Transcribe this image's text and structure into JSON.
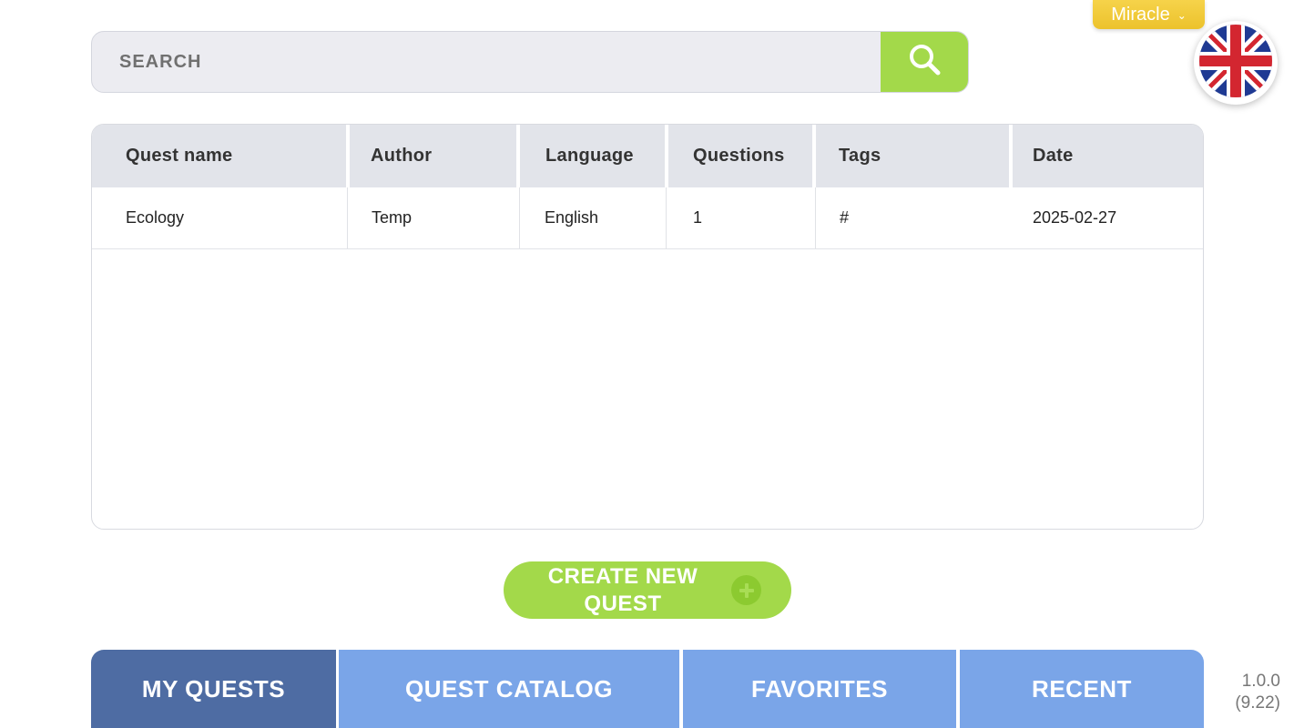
{
  "search": {
    "placeholder": "SEARCH"
  },
  "profile": {
    "name": "Miracle",
    "language_flag": "uk-flag-icon"
  },
  "table": {
    "columns": [
      "Quest name",
      "Author",
      "Language",
      "Questions",
      "Tags",
      "Date"
    ],
    "rows": [
      {
        "name": "Ecology",
        "author": "Temp",
        "language": "English",
        "questions": "1",
        "tags": "#",
        "date": "2025-02-27"
      }
    ]
  },
  "create_button": {
    "label": "CREATE NEW QUEST"
  },
  "tabs": [
    {
      "label": "MY QUESTS",
      "active": true
    },
    {
      "label": "QUEST CATALOG",
      "active": false
    },
    {
      "label": "FAVORITES",
      "active": false
    },
    {
      "label": "RECENT",
      "active": false
    }
  ],
  "version": {
    "app": "1.0.0",
    "build": "(9.22)"
  },
  "colors": {
    "accent_green": "#a3d94a",
    "tab_active": "#4e6ca3",
    "tab_inactive": "#7aa5e8",
    "profile_yellow": "#f2c933"
  }
}
